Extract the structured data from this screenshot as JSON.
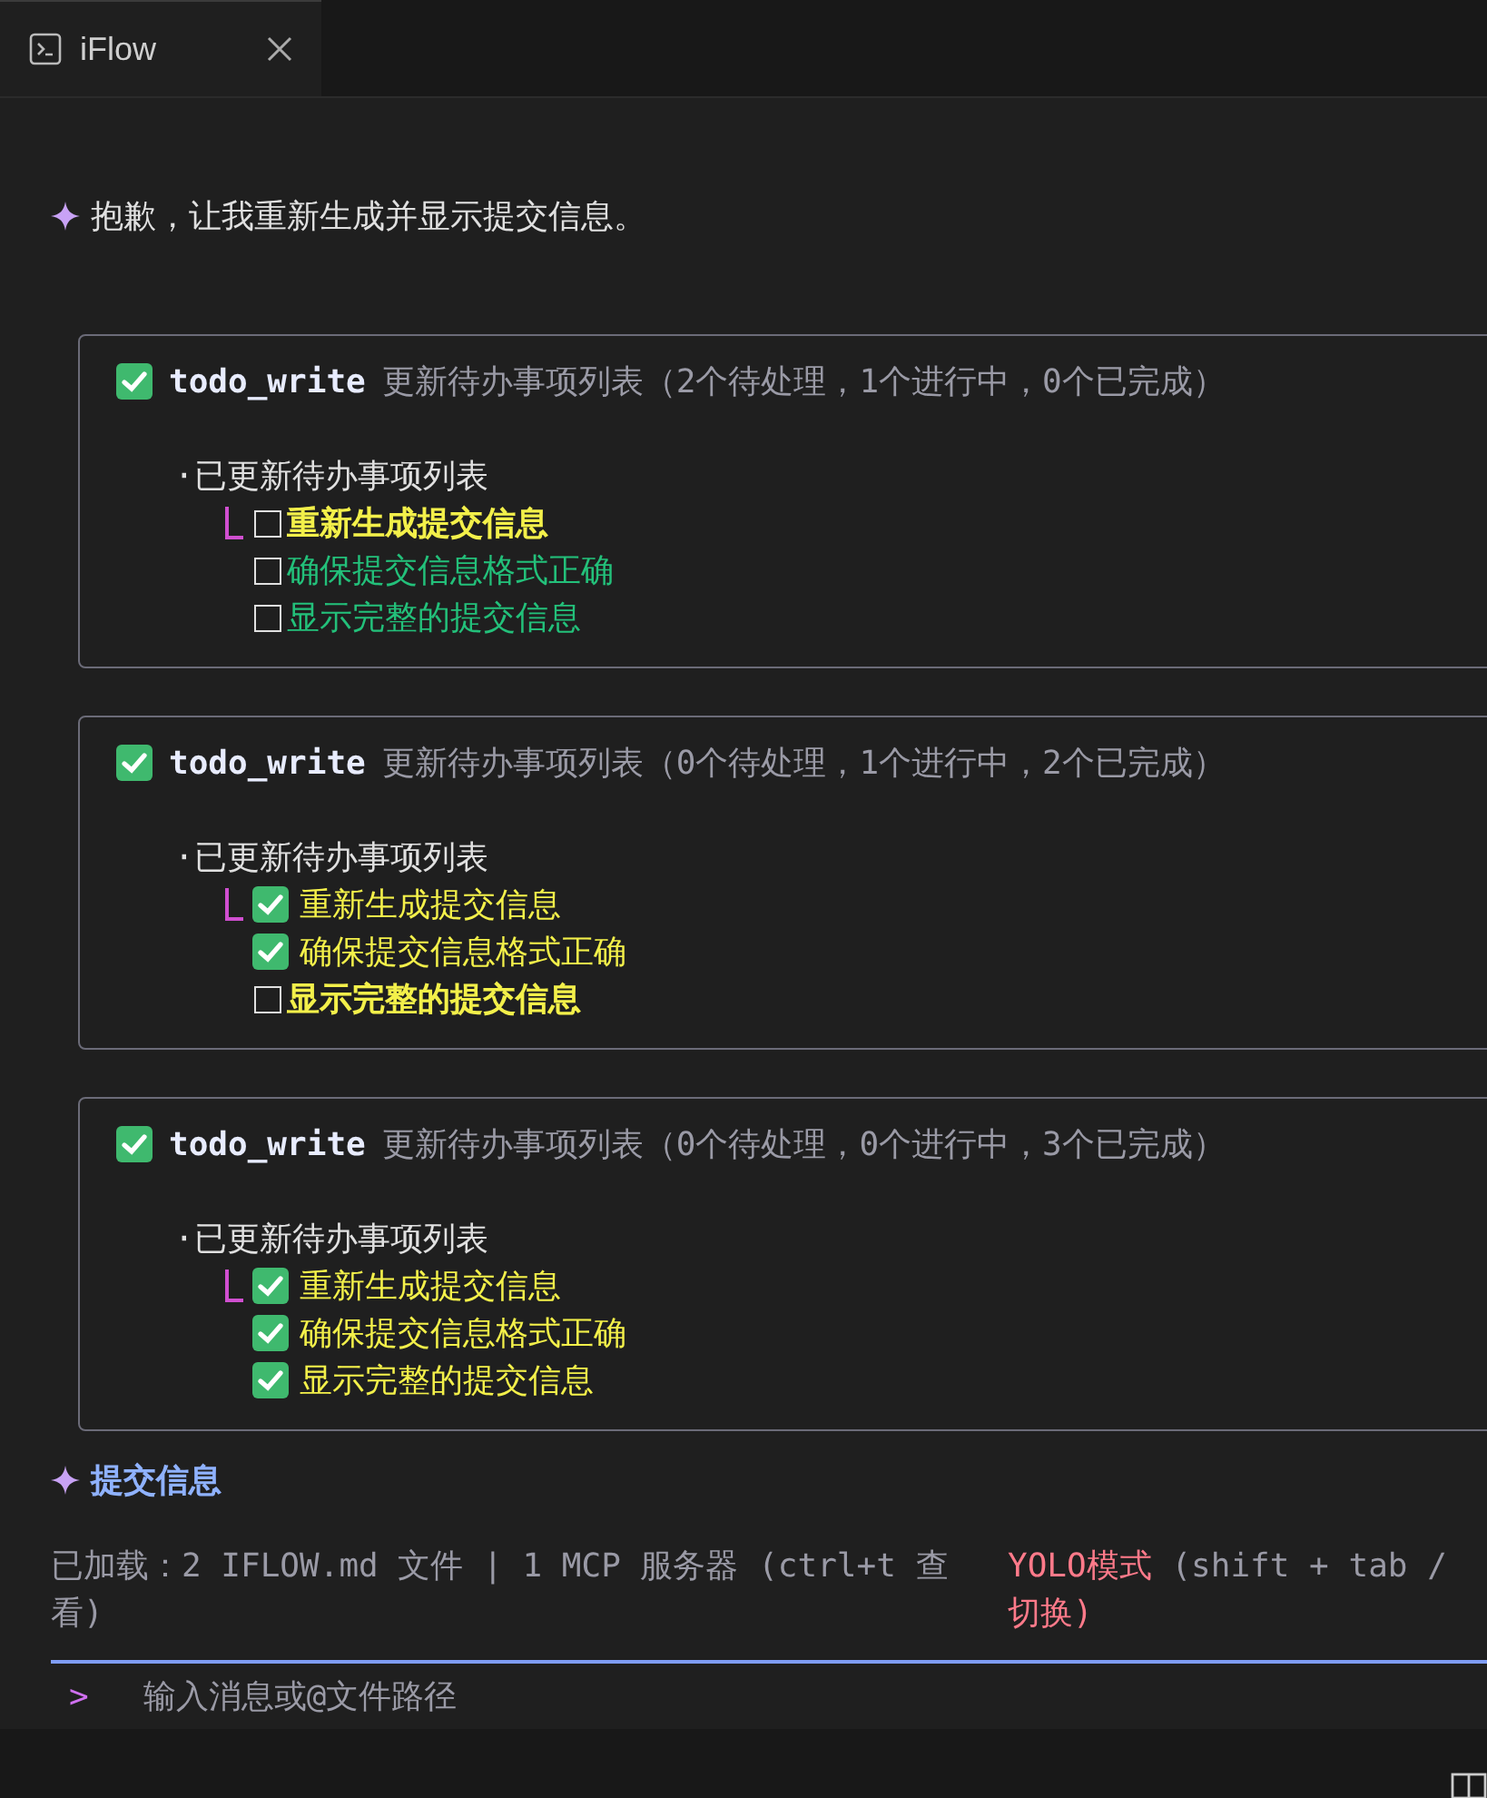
{
  "tab": {
    "title": "iFlow",
    "selected": true
  },
  "intro": "抱歉，让我重新生成并显示提交信息。",
  "cards": [
    {
      "tool": "todo_write",
      "summary": "更新待办事项列表（2个待处理，1个进行中，0个已完成）",
      "heading": "·已更新待办事项列表",
      "items": [
        {
          "text": "重新生成提交信息",
          "kind": "active"
        },
        {
          "text": "确保提交信息格式正确",
          "kind": "pending"
        },
        {
          "text": "显示完整的提交信息",
          "kind": "pending"
        }
      ]
    },
    {
      "tool": "todo_write",
      "summary": "更新待办事项列表（0个待处理，1个进行中，2个已完成）",
      "heading": "·已更新待办事项列表",
      "items": [
        {
          "text": "重新生成提交信息",
          "kind": "done"
        },
        {
          "text": "确保提交信息格式正确",
          "kind": "done"
        },
        {
          "text": "显示完整的提交信息",
          "kind": "active"
        }
      ]
    },
    {
      "tool": "todo_write",
      "summary": "更新待办事项列表（0个待处理，0个进行中，3个已完成）",
      "heading": "·已更新待办事项列表",
      "items": [
        {
          "text": "重新生成提交信息",
          "kind": "done"
        },
        {
          "text": "确保提交信息格式正确",
          "kind": "done"
        },
        {
          "text": "显示完整的提交信息",
          "kind": "done"
        }
      ]
    }
  ],
  "title": "提交信息",
  "status": {
    "loaded": "已加载：2 IFLOW.md 文件 | 1 MCP 服务器 (ctrl+t 查看)",
    "mode": "YOLO模式",
    "mode_hint": "(shift + tab / 切换)"
  },
  "input": {
    "prompt": ">",
    "placeholder": "输入消息或@文件路径"
  }
}
